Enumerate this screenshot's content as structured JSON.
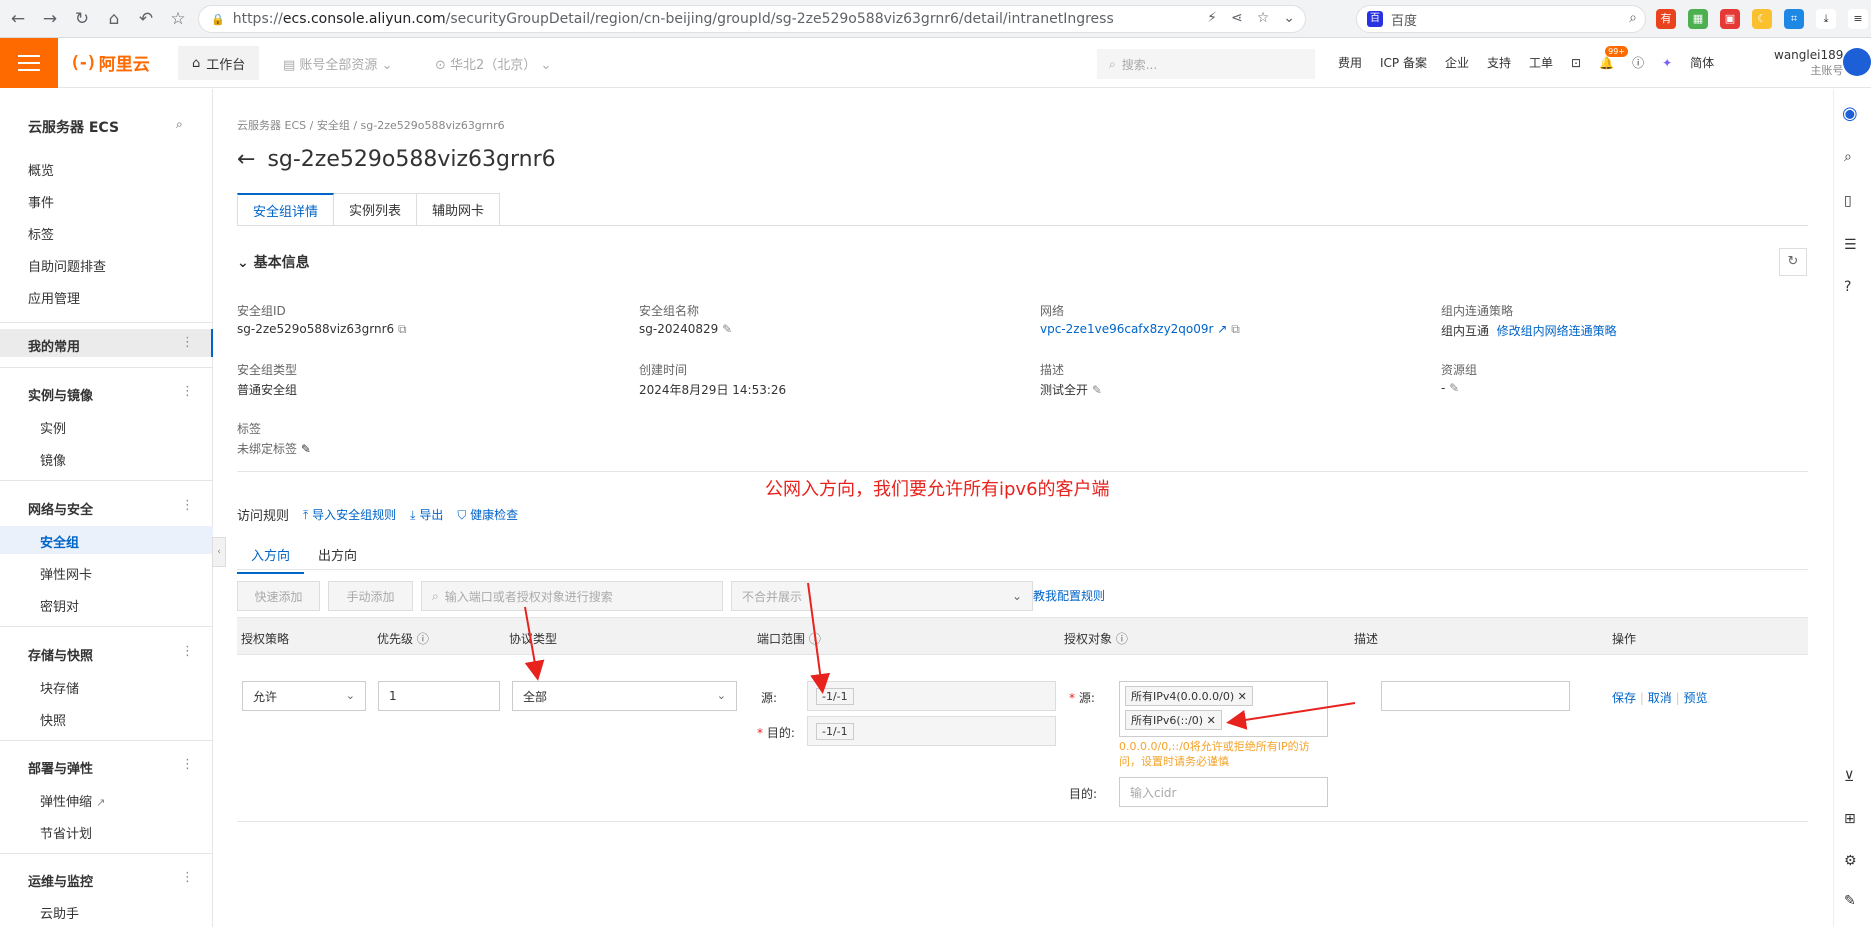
{
  "browser": {
    "url_prefix": "https://",
    "url_host": "ecs.console.aliyun.com",
    "url_path": "/securityGroupDetail/region/cn-beijing/groupId/sg-2ze529o588viz63grnr6/detail/intranetIngress",
    "search_engine": "百度"
  },
  "topbar": {
    "logo": "阿里云",
    "workbench": "工作台",
    "resources": "账号全部资源",
    "region": "华北2（北京）",
    "search_placeholder": "搜索...",
    "nav": [
      "费用",
      "ICP 备案",
      "企业",
      "支持",
      "工单"
    ],
    "badge": "99+",
    "lang": "简体",
    "user": "wanglei189",
    "user_role": "主账号"
  },
  "sidebar": {
    "title": "云服务器 ECS",
    "top_items": [
      "概览",
      "事件",
      "标签",
      "自助问题排查",
      "应用管理"
    ],
    "favorites": "我的常用",
    "groups": [
      {
        "name": "实例与镜像",
        "items": [
          "实例",
          "镜像"
        ]
      },
      {
        "name": "网络与安全",
        "items": [
          "安全组",
          "弹性网卡",
          "密钥对"
        ]
      },
      {
        "name": "存储与快照",
        "items": [
          "块存储",
          "快照"
        ]
      },
      {
        "name": "部署与弹性",
        "items": [
          "弹性伸缩",
          "节省计划"
        ]
      },
      {
        "name": "运维与监控",
        "items": [
          "云助手"
        ]
      }
    ]
  },
  "main": {
    "breadcrumb": [
      "云服务器 ECS",
      "安全组",
      "sg-2ze529o588viz63grnr6"
    ],
    "title": "sg-2ze529o588viz63grnr6",
    "tabs": [
      "安全组详情",
      "实例列表",
      "辅助网卡"
    ],
    "basic_info": "基本信息",
    "fields": {
      "sg_id_label": "安全组ID",
      "sg_id": "sg-2ze529o588viz63grnr6",
      "sg_name_label": "安全组名称",
      "sg_name": "sg-20240829",
      "network_label": "网络",
      "network": "vpc-2ze1ve96cafx8zy2qo09r",
      "policy_label": "组内连通策略",
      "policy": "组内互通",
      "policy_link": "修改组内网络连通策略",
      "type_label": "安全组类型",
      "type": "普通安全组",
      "created_label": "创建时间",
      "created": "2024年8月29日 14:53:26",
      "desc_label": "描述",
      "desc": "测试全开",
      "rg_label": "资源组",
      "rg": "-",
      "tag_label": "标签",
      "tag": "未绑定标签"
    },
    "annotation": "公网入方向，我们要允许所有ipv6的客户端",
    "rules": {
      "label": "访问规则",
      "import": "导入安全组规则",
      "export": "导出",
      "health": "健康检查",
      "subtabs": [
        "入方向",
        "出方向"
      ],
      "quick_add": "快速添加",
      "manual_add": "手动添加",
      "search_placeholder": "输入端口或者授权对象进行搜索",
      "merge": "不合并展示",
      "teach": "教我配置规则",
      "headers": [
        "授权策略",
        "优先级",
        "协议类型",
        "端口范围",
        "授权对象",
        "描述",
        "操作"
      ],
      "row": {
        "policy": "允许",
        "priority": "1",
        "protocol": "全部",
        "src_label": "源:",
        "src_port": "-1/-1",
        "dst_label": "目的:",
        "dst_port": "-1/-1",
        "obj_src_label": "源:",
        "obj_chip1": "所有IPv4(0.0.0.0/0)",
        "obj_chip2": "所有IPv6(::/0)",
        "hint": "0.0.0.0/0,::/0将允许或拒绝所有IP的访问，设置时请务必谨慎",
        "obj_dst_label": "目的:",
        "cidr_placeholder": "输入cidr",
        "op_save": "保存",
        "op_cancel": "取消",
        "op_preview": "预览"
      }
    }
  },
  "colors": {
    "accent": "#0064c8",
    "brand": "#ff6a00",
    "annotation": "#e8231e",
    "warning": "#f4a32a"
  }
}
